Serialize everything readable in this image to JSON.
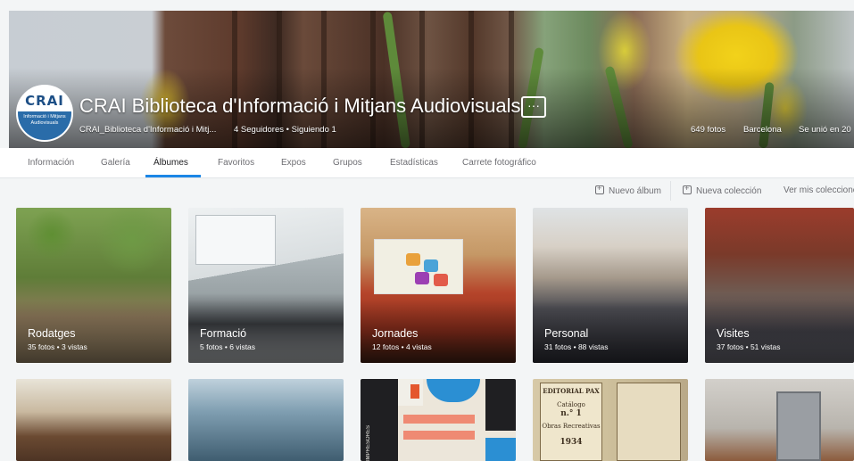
{
  "header": {
    "logo_text": "CRAI",
    "logo_subtext": "Informació i Mitjans Audiovisuals",
    "title": "CRAI Biblioteca d'Informació i Mitjans Audiovisuals",
    "more_icon": "ellipsis-icon",
    "more_label": "···",
    "username": "CRAI_Biblioteca d'Informació i Mitj...",
    "follow_info": "4 Seguidores  •  Siguiendo 1",
    "photos": "649 fotos",
    "location": "Barcelona",
    "joined": "Se unió en 20"
  },
  "tabs": [
    {
      "label": "Información"
    },
    {
      "label": "Galería"
    },
    {
      "label": "Álbumes",
      "active": true
    },
    {
      "label": "Favoritos"
    },
    {
      "label": "Expos"
    },
    {
      "label": "Grupos"
    },
    {
      "label": "Estadísticas"
    },
    {
      "label": "Carrete fotográfico"
    }
  ],
  "actions": {
    "new_album": "Nuevo álbum",
    "new_collection": "Nueva colección",
    "view_collections": "Ver mis coleccione"
  },
  "albums": [
    {
      "name": "Rodatges",
      "meta": "35 fotos  •  3 vistas"
    },
    {
      "name": "Formació",
      "meta": "5 fotos  •  6 vistas"
    },
    {
      "name": "Jornades",
      "meta": "12 fotos  •  4 vistas"
    },
    {
      "name": "Personal",
      "meta": "31 fotos  •  88 vistas"
    },
    {
      "name": "Visites",
      "meta": "37 fotos  •  51 vistas"
    }
  ],
  "albums_row2_text": {
    "doc_header": "EDITORIAL PAX",
    "doc_catalog": "Catálogo",
    "doc_number": "n.° 1",
    "doc_subtitle": "Obras Recreativas",
    "doc_year": "1934",
    "book_side": "IMPRESORES"
  },
  "colors": {
    "accent": "#1b86e6",
    "tab_text": "#6e6e73",
    "logo_blue": "#2a6ca9"
  }
}
